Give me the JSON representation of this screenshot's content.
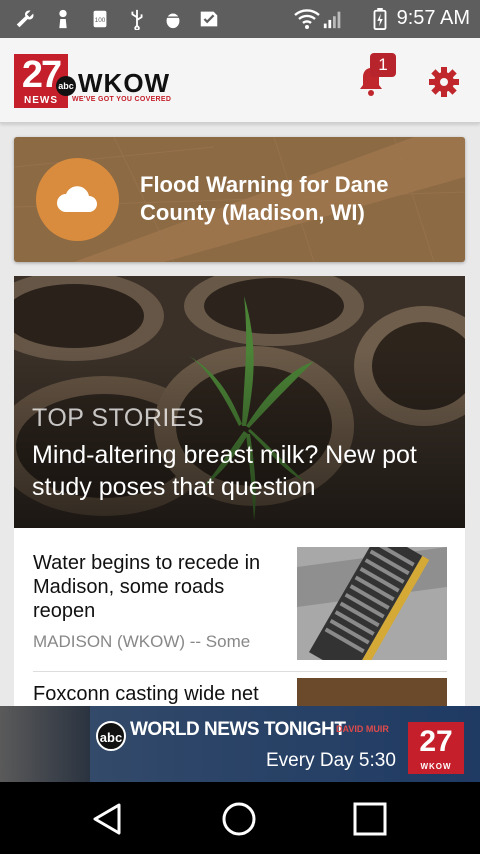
{
  "status_bar": {
    "time": "9:57 AM",
    "icons": [
      "wrench-icon",
      "chess-pawn-icon",
      "storage-100-icon",
      "usb-icon",
      "android-debug-icon",
      "checkbox-icon",
      "wifi-icon",
      "cell-signal-icon",
      "battery-charging-icon"
    ]
  },
  "header": {
    "logo_number": "27",
    "logo_network": "abc",
    "logo_news": "NEWS",
    "logo_station": "WKOW",
    "logo_tagline": "WE'VE GOT YOU COVERED",
    "notification_count": "1"
  },
  "alert": {
    "title": "Flood Warning for Dane County (Madison, WI)"
  },
  "top_story": {
    "label": "TOP STORIES",
    "headline": "Mind-altering breast milk? New pot study poses that question"
  },
  "stories": [
    {
      "title": "Water begins to recede in Madison, some roads reopen",
      "snippet": "MADISON (WKOW) -- Some"
    },
    {
      "title": "Foxconn casting wide net"
    }
  ],
  "ad": {
    "network": "abc",
    "title": "WORLD NEWS TONIGHT",
    "anchor": "DAVID MUIR",
    "schedule": "Every Day 5:30",
    "station_number": "27",
    "station_name": "WKOW"
  },
  "colors": {
    "brand_red": "#c41f2a",
    "alert_brown": "#8c6a44",
    "alert_circle": "#d98c3e",
    "status_bar": "#5e5e5e"
  }
}
